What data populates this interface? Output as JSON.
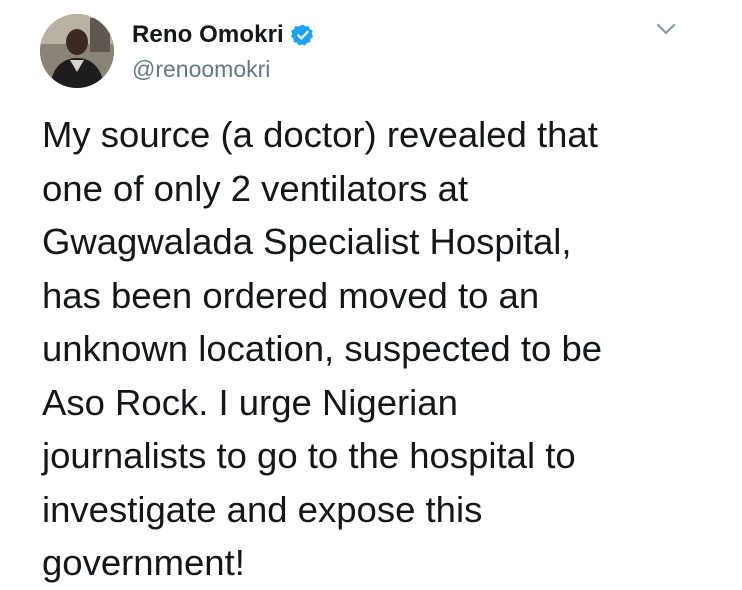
{
  "author": {
    "display_name": "Reno Omokri",
    "handle": "@renoomokri",
    "verified": true
  },
  "icons": {
    "verified": "verified-badge-icon",
    "menu": "chevron-down-icon",
    "avatar": "profile-photo"
  },
  "colors": {
    "text": "#14171a",
    "secondary_text": "#657786",
    "verified_blue": "#1da1f2"
  },
  "tweet": {
    "text": "My source (a doctor) revealed that\none of only 2 ventilators at\nGwagwalada Specialist Hospital,\nhas been ordered moved to an\nunknown location, suspected to be\nAso Rock. I urge Nigerian\njournalists to go to the hospital to\ninvestigate and expose this\ngovernment!"
  }
}
